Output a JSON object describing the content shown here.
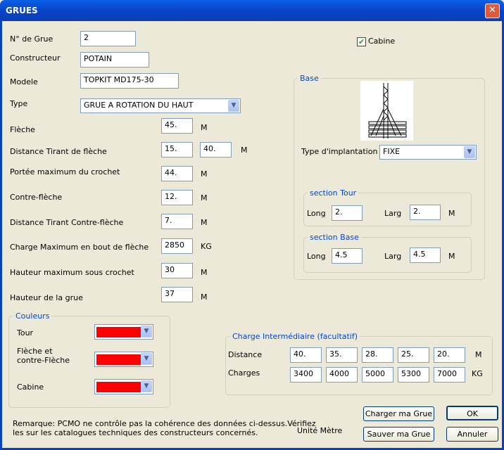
{
  "window": {
    "title": "GRUES"
  },
  "crane": {
    "number_label": "N° de Grue",
    "number": "2",
    "maker_label": "Constructeur",
    "maker": "POTAIN",
    "model_label": "Modele",
    "model": "TOPKIT MD175-30",
    "type_label": "Type",
    "type": "GRUE A ROTATION DU HAUT",
    "jib_label": "Flèche",
    "jib": "45.",
    "jib_unit": "M",
    "jib_tie_label": "Distance Tirant de flèche",
    "jib_tie_1": "15.",
    "jib_tie_2": "40.",
    "jib_tie_unit": "M",
    "reach_label": "Portée maximum du crochet",
    "reach": "44.",
    "reach_unit": "M",
    "counter_label": "Contre-flèche",
    "counter": "12.",
    "counter_unit": "M",
    "counter_tie_label": "Distance Tirant Contre-flèche",
    "counter_tie": "7.",
    "counter_tie_unit": "M",
    "tip_load_label": "Charge Maximum en bout de flèche",
    "tip_load": "2850",
    "tip_load_unit": "KG",
    "hook_height_label": "Hauteur maximum sous crochet",
    "hook_height": "30",
    "hook_height_unit": "M",
    "height_label": "Hauteur de la grue",
    "height": "37",
    "height_unit": "M"
  },
  "cabin": {
    "label": "Cabine",
    "checked": true
  },
  "base": {
    "title": "Base",
    "implant_label": "Type d'implantation",
    "implant": "FIXE",
    "tower_section": {
      "title": "section Tour",
      "long_label": "Long",
      "long": "2.",
      "larg_label": "Larg",
      "larg": "2.",
      "unit": "M"
    },
    "base_section": {
      "title": "section Base",
      "long_label": "Long",
      "long": "4.5",
      "larg_label": "Larg",
      "larg": "4.5",
      "unit": "M"
    }
  },
  "colors": {
    "title": "Couleurs",
    "tower_label": "Tour",
    "jib_label_1": "Flèche et",
    "jib_label_2": "contre-Flèche",
    "cabin_label": "Cabine",
    "tower": "#ff0000",
    "jib": "#ff0000",
    "cabin": "#ff0000"
  },
  "intermediate": {
    "title": "Charge Intermédiaire (facultatif)",
    "distance_label": "Distance",
    "distances": [
      "40.",
      "35.",
      "28.",
      "25.",
      "20."
    ],
    "distance_unit": "M",
    "charges_label": "Charges",
    "charges": [
      "3400",
      "4000",
      "5000",
      "5300",
      "7000"
    ],
    "charges_unit": "KG"
  },
  "remark": {
    "line1": "Remarque: PCMO ne contrôle pas la cohérence des données ci-dessus.Vérifiez",
    "line2": "les sur les catalogues techniques des constructeurs concernés."
  },
  "unit_text": "Unité Mètre",
  "buttons": {
    "load": "Charger ma Grue",
    "save": "Sauver ma Grue",
    "ok": "OK",
    "cancel": "Annuler"
  }
}
